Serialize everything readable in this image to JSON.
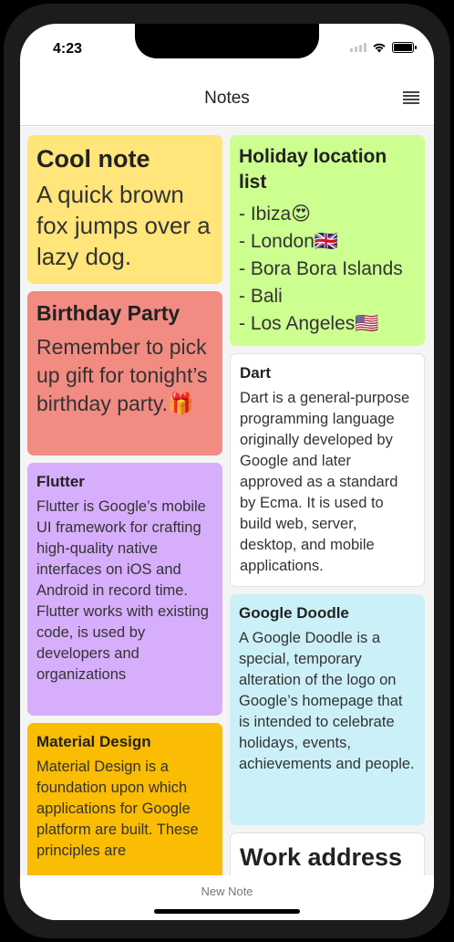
{
  "status": {
    "time": "4:23"
  },
  "nav": {
    "title": "Notes",
    "menu_icon": "view-list-icon"
  },
  "notes": {
    "cool": {
      "title": "Cool note",
      "body": "A quick brown fox jumps over a lazy dog.",
      "color": "#ffe57a"
    },
    "birthday": {
      "title": "Birthday Party",
      "body": "Remember to pick up gift for tonight’s birthday party.🎁",
      "color": "#f28b82"
    },
    "flutter": {
      "title": "Flutter",
      "body": "Flutter is Google’s mobile UI framework for crafting high-quality native interfaces on iOS and Android in record time. Flutter works with existing code, is used by developers and organizations",
      "color": "#d7aefb"
    },
    "material": {
      "title": "Material Design",
      "body": "Material Design is a foundation upon which applications for Google platform are built. These principles are",
      "color": "#fbbc04"
    },
    "holiday": {
      "title": "Holiday location list",
      "items": [
        "- Ibiza😍",
        "- London🇬🇧",
        "- Bora Bora Islands",
        "- Bali",
        "- Los Angeles🇺🇸"
      ],
      "color": "#ccff90"
    },
    "dart": {
      "title": "Dart",
      "body": "Dart is a general-purpose programming language originally developed by Google and later approved as a standard by Ecma. It is used to build web, server, desktop, and mobile applications.",
      "color": "#ffffff"
    },
    "doodle": {
      "title": "Google Doodle",
      "body": "A Google Doodle is a special, temporary alteration of the logo on Google’s homepage that is intended to celebrate holidays, events, achievements and people.",
      "color": "#cbf0f8"
    },
    "work": {
      "title": "Work address"
    }
  },
  "footer": {
    "new_note_label": "New Note"
  }
}
